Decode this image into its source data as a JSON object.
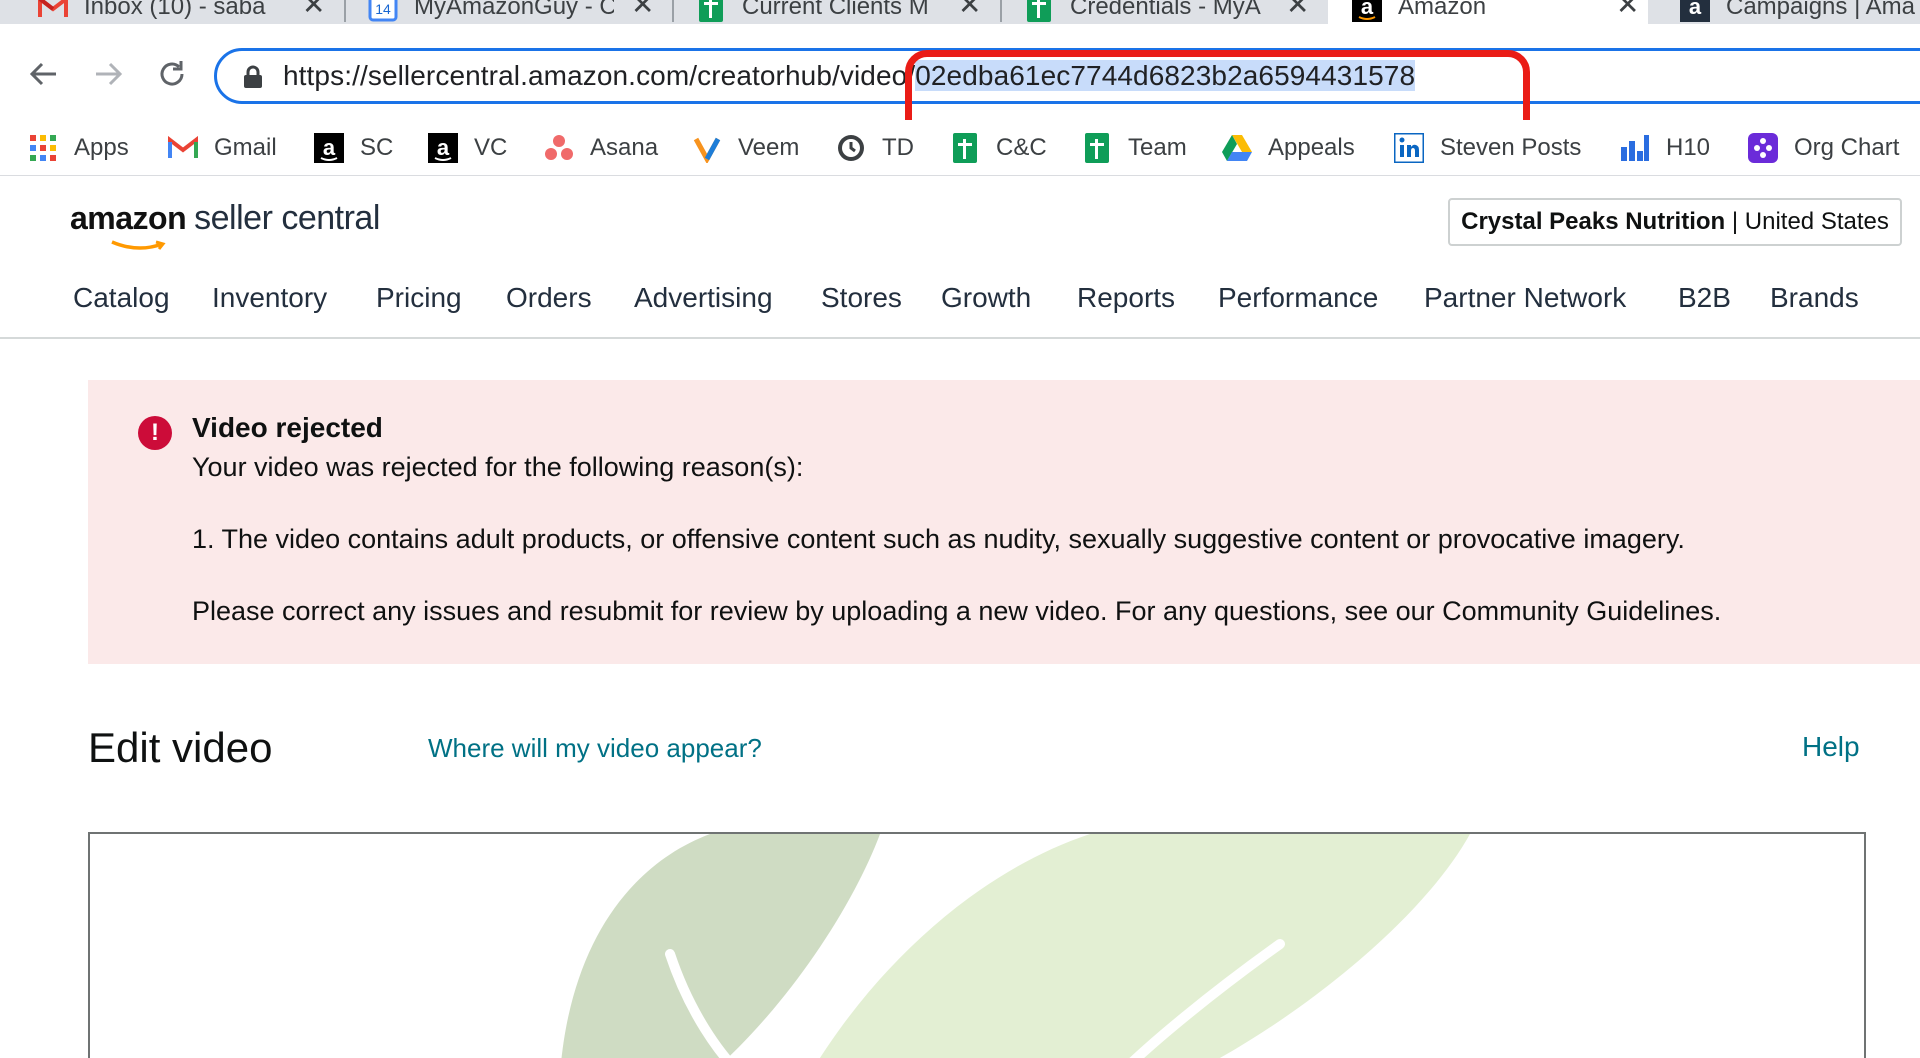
{
  "browser": {
    "tabs": [
      {
        "title": "Inbox (10) - saba",
        "favicon": "gmail-icon",
        "active": false
      },
      {
        "title": "MyAmazonGuy - C",
        "favicon": "calendar-icon",
        "favicon_text": "14",
        "active": false
      },
      {
        "title": "Current Clients M",
        "favicon": "sheets-icon",
        "active": false
      },
      {
        "title": "Credentials - MyA",
        "favicon": "sheets-icon",
        "active": false
      },
      {
        "title": "Amazon",
        "favicon": "amazon-icon",
        "active": true
      },
      {
        "title": "Campaigns | Ama",
        "favicon": "amazon-icon",
        "active": false
      }
    ],
    "close_glyph": "✕",
    "url_prefix": "https://sellercentral.amazon.com/creatorhub/video/",
    "url_selected": "02edba61ec7744d6823b2a6594431578",
    "bookmarks": [
      {
        "label": "Apps",
        "icon": "apps-grid-icon"
      },
      {
        "label": "Gmail",
        "icon": "gmail-icon"
      },
      {
        "label": "SC",
        "icon": "amazon-icon"
      },
      {
        "label": "VC",
        "icon": "amazon-icon"
      },
      {
        "label": "Asana",
        "icon": "asana-icon"
      },
      {
        "label": "Veem",
        "icon": "veem-icon"
      },
      {
        "label": "TD",
        "icon": "clock-icon"
      },
      {
        "label": "C&C",
        "icon": "sheets-icon"
      },
      {
        "label": "Team",
        "icon": "sheets-icon"
      },
      {
        "label": "Appeals",
        "icon": "drive-icon"
      },
      {
        "label": "Steven Posts",
        "icon": "linkedin-icon"
      },
      {
        "label": "H10",
        "icon": "helium10-icon"
      },
      {
        "label": "Org Chart",
        "icon": "orgchart-icon"
      }
    ]
  },
  "header": {
    "logo_amazon": "amazon",
    "logo_seller": "seller central",
    "account_name": "Crystal Peaks Nutrition",
    "account_divider": " | ",
    "account_region": "United States",
    "nav": [
      "Catalog",
      "Inventory",
      "Pricing",
      "Orders",
      "Advertising",
      "Stores",
      "Growth",
      "Reports",
      "Performance",
      "Partner Network",
      "B2B",
      "Brands"
    ]
  },
  "alert": {
    "icon_glyph": "!",
    "title": "Video rejected",
    "intro": "Your video was rejected for the following reason(s):",
    "reason": "1. The video contains adult products, or offensive content such as nudity, sexually suggestive content or provocative imagery.",
    "instructions": "Please correct any issues and resubmit for review by uploading a new video. For any questions, see our Community Guidelines."
  },
  "edit": {
    "title": "Edit video",
    "where_link": "Where will my video appear?",
    "help_link": "Help"
  },
  "colors": {
    "accent_blue": "#1a73e8",
    "annotation_red": "#ea1c16",
    "alert_bg": "#fbe9e9",
    "alert_icon": "#cc0c39",
    "link": "#007185",
    "leaf_dark": "#cfdcc3",
    "leaf_light": "#e3efd3"
  }
}
